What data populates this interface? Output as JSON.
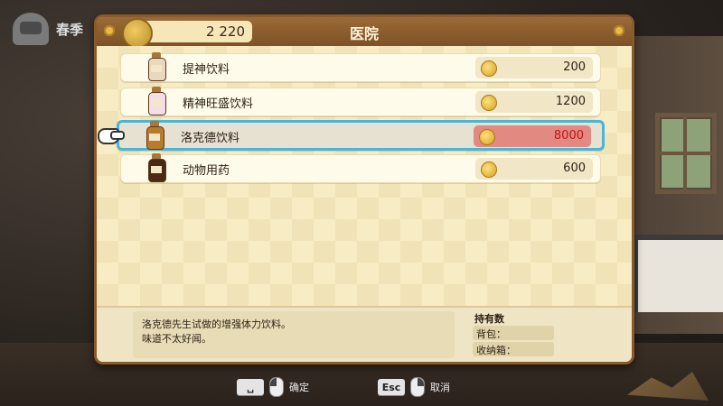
{
  "hud": {
    "season": "春季"
  },
  "shop": {
    "title": "医院",
    "money": "2 220",
    "items": [
      {
        "name": "提神饮料",
        "price": "200",
        "affordable": true,
        "bottle_color": "#e9d7c0"
      },
      {
        "name": "精神旺盛饮料",
        "price": "1200",
        "affordable": true,
        "bottle_color": "#f4dde4"
      },
      {
        "name": "洛克德饮料",
        "price": "8000",
        "affordable": false,
        "bottle_color": "#b97a2c",
        "selected": true
      },
      {
        "name": "动物用药",
        "price": "600",
        "affordable": true,
        "bottle_color": "#4a2a14"
      }
    ],
    "description": [
      "洛克德先生试做的增强体力饮料。",
      "味道不太好闻。"
    ],
    "owned": {
      "title": "持有数",
      "bag_label": "背包：",
      "storage_label": "收纳箱："
    }
  },
  "controls": {
    "confirm_key": "␣",
    "confirm_label": "确定",
    "cancel_key": "Esc",
    "cancel_label": "取消"
  },
  "colors": {
    "selection": "#4ab5d8",
    "unaffordable": "#c0141a",
    "panel_frame": "#8a5a2c"
  }
}
